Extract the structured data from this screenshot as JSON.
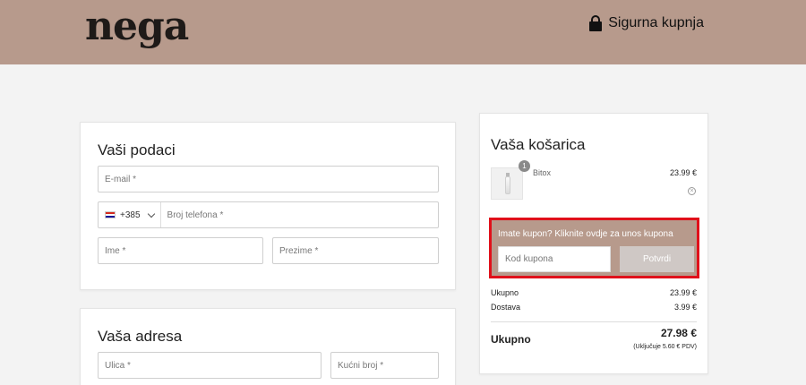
{
  "header": {
    "logo": "nega",
    "secure_label": "Sigurna kupnja",
    "background": "#b79a8c"
  },
  "details": {
    "title": "Vaši podaci",
    "email_placeholder": "E-mail *",
    "phone_prefix": "+385",
    "phone_placeholder": "Broj telefona *",
    "first_name_placeholder": "Ime *",
    "last_name_placeholder": "Prezime *"
  },
  "address": {
    "title": "Vaša adresa",
    "street_placeholder": "Ulica *",
    "house_number_placeholder": "Kućni broj *"
  },
  "cart": {
    "title": "Vaša košarica",
    "items": [
      {
        "name": "Bitox",
        "price": "23.99 €",
        "quantity": "1"
      }
    ],
    "coupon": {
      "prompt": "Imate kupon? Kliknite ovdje za unos kupona",
      "input_placeholder": "Kod kupona",
      "button_label": "Potvrdi",
      "highlight_color": "#e0101a"
    },
    "subtotal_label": "Ukupno",
    "subtotal_value": "23.99 €",
    "shipping_label": "Dostava",
    "shipping_value": "3.99 €",
    "total_label": "Ukupno",
    "total_value": "27.98 €",
    "vat_note": "(Uključuje 5.60 € PDV)"
  }
}
